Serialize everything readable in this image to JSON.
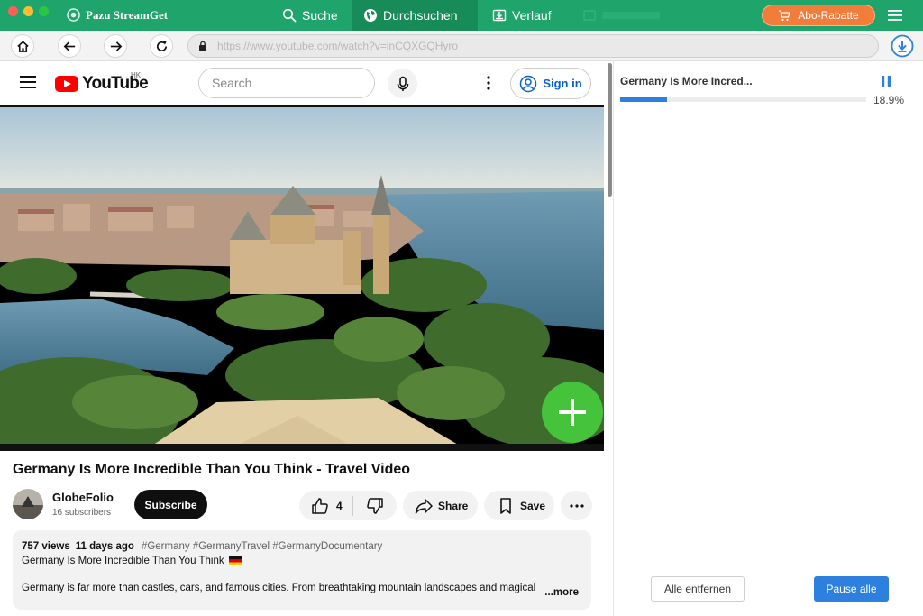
{
  "app": {
    "name": "Pazu StreamGet",
    "tabs": [
      {
        "label": "Suche",
        "icon": "search-icon"
      },
      {
        "label": "Durchsuchen",
        "icon": "globe-icon",
        "active": true
      },
      {
        "label": "Verlauf",
        "icon": "download-history-icon"
      }
    ],
    "promo_label": "Abo-Rabatte",
    "accent_color": "#1fa46b",
    "promo_color": "#f27d3a"
  },
  "browser": {
    "url": "https://www.youtube.com/watch?v=inCQXGQHyro"
  },
  "youtube": {
    "logo_text": "YouTube",
    "region": "HK",
    "search_placeholder": "Search",
    "sign_in": "Sign in",
    "video": {
      "title": "Germany Is More Incredible Than You Think - Travel Video",
      "channel": "GlobeFolio",
      "subscribers": "16 subscribers",
      "subscribe_label": "Subscribe",
      "likes": "4",
      "share_label": "Share",
      "save_label": "Save",
      "views": "757 views",
      "age": "11 days ago",
      "tags": "#Germany #GermanyTravel #GermanyDocumentary",
      "desc_line1": "Germany Is More Incredible Than You Think",
      "desc_line2": "Germany is far more than castles, cars, and famous cities. From breathtaking mountain landscapes and magical",
      "more_label": "...more"
    }
  },
  "downloads": {
    "item_title": "Germany Is More Incred...",
    "progress_percent": 18.9,
    "progress_text": "18.9%",
    "remove_all_label": "Alle entfernen",
    "pause_all_label": "Pause alle",
    "progress_color": "#2d80de"
  }
}
